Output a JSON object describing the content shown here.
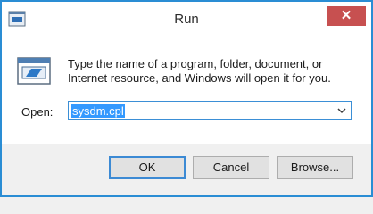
{
  "window": {
    "title": "Run",
    "close_label": "✕",
    "accent_color": "#2a8dd4",
    "close_color": "#c75050"
  },
  "content": {
    "description": "Type the name of a program, folder, document, or Internet resource, and Windows will open it for you.",
    "open_label": "Open:",
    "open_value": "sysdm.cpl",
    "selection_color": "#3399ff",
    "icon": "run-dialog-icon"
  },
  "buttons": {
    "ok": "OK",
    "cancel": "Cancel",
    "browse": "Browse..."
  }
}
